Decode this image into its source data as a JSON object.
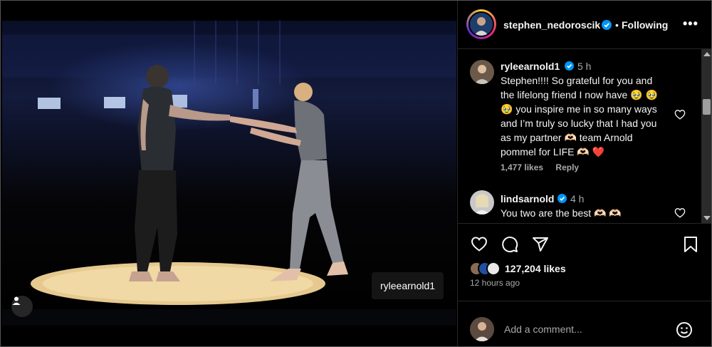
{
  "post": {
    "media_tag": "ryleearnold1",
    "author": {
      "username": "stephen_nedoroscik",
      "follow_status": "Following"
    }
  },
  "comments": [
    {
      "username": "ryleearnold1",
      "time": "5 h",
      "text": "Stephen!!!! So grateful for you and the lifelong friend I now have 🥹 🥹 🥹 you inspire me in so many ways and I’m truly so lucky that I had you as my partner 🫶🏻 team Arnold pommel for LIFE 🫶🏻 ❤️",
      "likes": "1,477 likes",
      "reply": "Reply"
    },
    {
      "username": "lindsarnold",
      "time": "4 h",
      "text": "You two are the best 🫶🏻 🫶🏻"
    }
  ],
  "likes_total": "127,204 likes",
  "posted_ago": "12 hours ago",
  "add_comment_placeholder": "Add a comment...",
  "icons": [
    "verified-icon",
    "more-icon",
    "heart-icon",
    "comment-icon",
    "share-icon",
    "bookmark-icon",
    "emoji-icon",
    "user-tag-icon"
  ],
  "colors": {
    "verified": "#0095f6",
    "like_heart": "#ff3040",
    "muted_text": "#a8a8a8"
  }
}
